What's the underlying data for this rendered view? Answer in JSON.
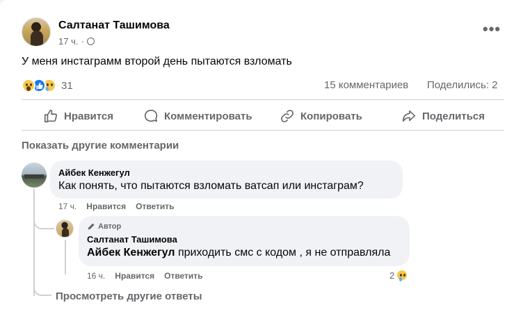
{
  "post": {
    "author": "Салтанат Ташимова",
    "time": "17 ч.",
    "separator": "·",
    "text": "У меня инстаграмм второй день  пытаются взломать",
    "more": "•••",
    "reactions_count": "31",
    "comments_count": "15 комментариев",
    "shares_count": "Поделились: 2"
  },
  "actions": {
    "like": "Нравится",
    "comment": "Комментировать",
    "copy": "Копировать",
    "share": "Поделиться"
  },
  "show_more_comments": "Показать другие комментарии",
  "comments": [
    {
      "author": "Айбек Кенжегул",
      "text": "Как понять, что пытаются взломать ватсап или инстаграм?",
      "time": "17 ч.",
      "like": "Нравится",
      "reply": "Ответить"
    }
  ],
  "reply": {
    "badge": "Автор",
    "author": "Салтанат Ташимова",
    "mention": "Айбек Кенжегул",
    "text": " приходить смс с кодом , я не отправляла",
    "time": "16 ч.",
    "like": "Нравится",
    "reply": "Ответить",
    "reaction_count": "2"
  },
  "view_more_replies": "Просмотреть другие ответы",
  "icons": {
    "globe": "globe-icon",
    "like": "thumbs-up-icon",
    "comment": "speech-bubble-icon",
    "copy": "link-icon",
    "share": "share-arrow-icon",
    "author_badge": "pencil-icon"
  },
  "colors": {
    "accent": "#1877f2",
    "secondary_text": "#65676b",
    "bubble": "#f0f2f5"
  }
}
